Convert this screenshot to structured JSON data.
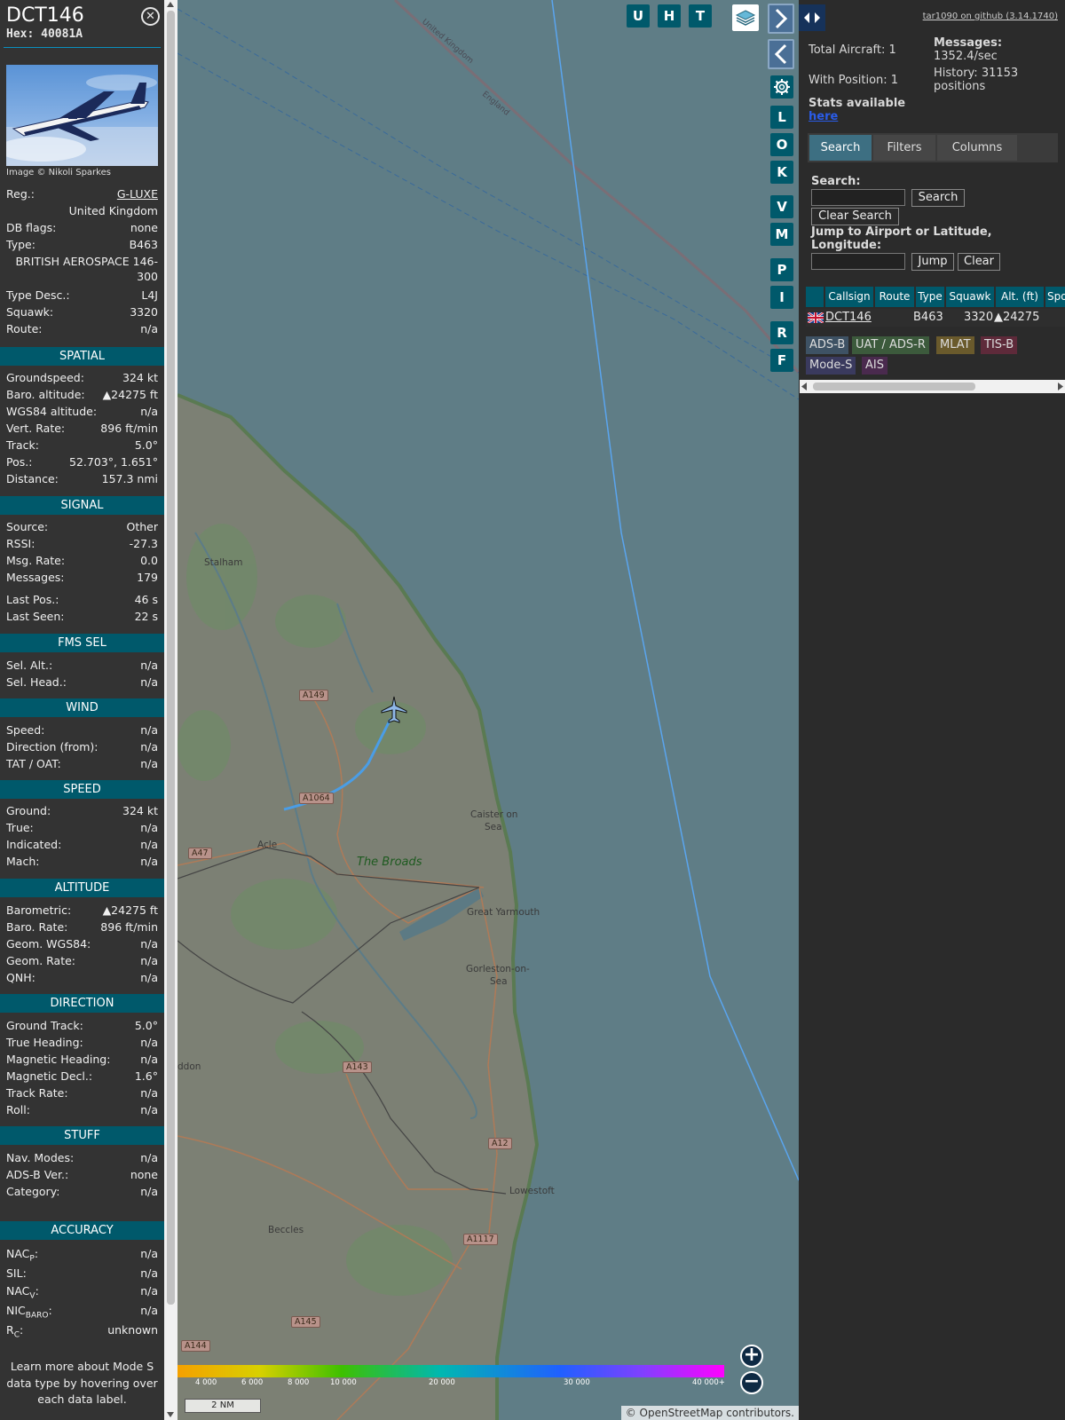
{
  "aircraft": {
    "callsign": "DCT146",
    "hex_label": "Hex:",
    "hex": "40081A",
    "photo_credit": "Image © Nikoli Sparkes"
  },
  "details": [
    {
      "key": "Reg.:",
      "value": "G-LUXE",
      "link": true
    },
    {
      "key": "DB flags:",
      "value": "none"
    },
    {
      "key": "Type:",
      "value": "B463"
    },
    {
      "key": "Type Desc.:",
      "value": "L4J"
    },
    {
      "key": "Squawk:",
      "value": "3320"
    },
    {
      "key": "Route:",
      "value": "n/a"
    }
  ],
  "reg_country": "United Kingdom",
  "type_full_line1": "BRITISH AEROSPACE 146-",
  "type_full_line2": "300",
  "sections": {
    "spatial": "SPATIAL",
    "signal": "SIGNAL",
    "fms": "FMS SEL",
    "wind": "WIND",
    "speed": "SPEED",
    "altitude": "ALTITUDE",
    "direction": "DIRECTION",
    "stuff": "STUFF",
    "accuracy": "ACCURACY"
  },
  "spatial": [
    {
      "key": "Groundspeed:",
      "value": "324 kt"
    },
    {
      "key": "Baro. altitude:",
      "value": "▲24275 ft"
    },
    {
      "key": "WGS84 altitude:",
      "value": "n/a"
    },
    {
      "key": "Vert. Rate:",
      "value": "896 ft/min"
    },
    {
      "key": "Track:",
      "value": "5.0°"
    },
    {
      "key": "Pos.:",
      "value": "52.703°, 1.651°"
    },
    {
      "key": "Distance:",
      "value": "157.3 nmi"
    }
  ],
  "signal": [
    {
      "key": "Source:",
      "value": "Other"
    },
    {
      "key": "RSSI:",
      "value": "-27.3"
    },
    {
      "key": "Msg. Rate:",
      "value": "0.0"
    },
    {
      "key": "Messages:",
      "value": "179"
    },
    {
      "key": "Last Pos.:",
      "value": "46 s"
    },
    {
      "key": "Last Seen:",
      "value": "22 s"
    }
  ],
  "fms": [
    {
      "key": "Sel. Alt.:",
      "value": "n/a"
    },
    {
      "key": "Sel. Head.:",
      "value": "n/a"
    }
  ],
  "wind": [
    {
      "key": "Speed:",
      "value": "n/a"
    },
    {
      "key": "Direction (from):",
      "value": "n/a"
    },
    {
      "key": "TAT / OAT:",
      "value": "n/a"
    }
  ],
  "speed": [
    {
      "key": "Ground:",
      "value": "324 kt"
    },
    {
      "key": "True:",
      "value": "n/a"
    },
    {
      "key": "Indicated:",
      "value": "n/a"
    },
    {
      "key": "Mach:",
      "value": "n/a"
    }
  ],
  "altitude": [
    {
      "key": "Barometric:",
      "value": "▲24275 ft"
    },
    {
      "key": "Baro. Rate:",
      "value": "896 ft/min"
    },
    {
      "key": "Geom. WGS84:",
      "value": "n/a"
    },
    {
      "key": "Geom. Rate:",
      "value": "n/a"
    },
    {
      "key": "QNH:",
      "value": "n/a"
    }
  ],
  "direction": [
    {
      "key": "Ground Track:",
      "value": "5.0°"
    },
    {
      "key": "True Heading:",
      "value": "n/a"
    },
    {
      "key": "Magnetic Heading:",
      "value": "n/a"
    },
    {
      "key": "Magnetic Decl.:",
      "value": "1.6°"
    },
    {
      "key": "Track Rate:",
      "value": "n/a"
    },
    {
      "key": "Roll:",
      "value": "n/a"
    }
  ],
  "stuff": [
    {
      "key": "Nav. Modes:",
      "value": "n/a"
    },
    {
      "key": "ADS-B Ver.:",
      "value": "none"
    },
    {
      "key": "Category:",
      "value": "n/a"
    }
  ],
  "accuracy": [
    {
      "key": "NAC",
      "sub": "P",
      "value": "n/a"
    },
    {
      "key": "SIL:",
      "sub": "",
      "value": "n/a"
    },
    {
      "key": "NAC",
      "sub": "V",
      "value": "n/a"
    },
    {
      "key": "NIC",
      "sub": "BARO",
      "value": "n/a"
    },
    {
      "key": "R",
      "sub": "C",
      "value": "unknown"
    }
  ],
  "footer_text": "Learn more about Mode S data type by hovering over each data label.",
  "map": {
    "top_buttons": [
      "U",
      "H",
      "T"
    ],
    "side_buttons": [
      "L",
      "O",
      "K",
      "V",
      "M",
      "P",
      "I",
      "R",
      "F"
    ],
    "zoom_in": "+",
    "zoom_out": "−",
    "scale_label": "2 NM",
    "attribution": "© OpenStreetMap contributors.",
    "legend_ticks": [
      "4 000",
      "6 000",
      "8 000",
      "10 000",
      "20 000",
      "30 000",
      "40 000+"
    ],
    "places": [
      "Stalham",
      "Acle",
      "The Broads",
      "Caister on",
      "Sea",
      "Great Yarmouth",
      "Gorleston-on-",
      "Sea",
      "Lowestoft",
      "Beccles",
      "ddon",
      "United Kingdom",
      "England"
    ],
    "roads": [
      "A149",
      "A1064",
      "A47",
      "A143",
      "A12",
      "A1117",
      "A145",
      "A144"
    ]
  },
  "panel": {
    "github": "tar1090 on github (3.14.1740)",
    "total_aircraft": "Total Aircraft: 1",
    "with_position": "With Position: 1",
    "stats_available": "Stats available",
    "stats_link": "here",
    "messages_label": "Messages:",
    "messages_rate": "1352.4/sec",
    "history_label": "History: 31153",
    "history_unit": "positions",
    "tabs": [
      "Search",
      "Filters",
      "Columns"
    ],
    "search_label": "Search:",
    "search_button": "Search",
    "clear_search_button": "Clear Search",
    "jump_label_1": "Jump to Airport or Latitude,",
    "jump_label_2": "Longitude:",
    "jump_button": "Jump",
    "clear_button": "Clear",
    "table_headers": [
      "Callsign",
      "Route",
      "Type",
      "Squawk",
      "Alt. (ft)",
      "Spd"
    ],
    "table_row": {
      "callsign": "DCT146",
      "route": "",
      "type": "B463",
      "squawk": "3320",
      "alt": "▲24275"
    },
    "sources": [
      "ADS-B",
      "UAT / ADS-R",
      "MLAT",
      "TIS-B",
      "Mode-S",
      "AIS"
    ]
  }
}
